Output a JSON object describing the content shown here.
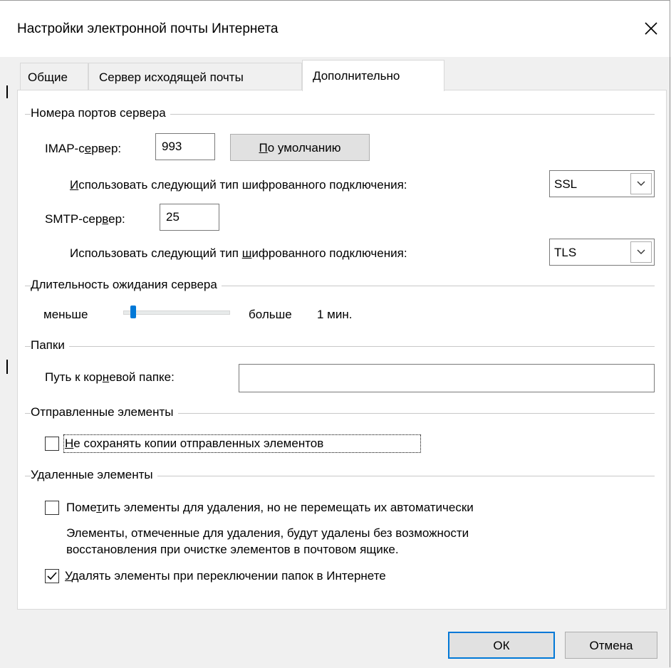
{
  "window": {
    "title": "Настройки электронной почты Интернета",
    "close_icon": "close-icon"
  },
  "tabs": [
    {
      "label": "Общие",
      "active": false
    },
    {
      "label": "Сервер исходящей почты",
      "active": false
    },
    {
      "label": "Дополнительно",
      "active": true
    }
  ],
  "ports": {
    "group_title": "Номера портов сервера",
    "imap_label_pre": "IMAP-с",
    "imap_label_ul": "е",
    "imap_label_post": "рвер:",
    "imap_value": "993",
    "default_button_pre": "",
    "default_button_ul": "П",
    "default_button_post": "о умолчанию",
    "imap_encryption_label_pre": "",
    "imap_encryption_label_ul": "И",
    "imap_encryption_label_post": "спользовать следующий тип шифрованного подключения:",
    "imap_encryption_value": "SSL",
    "smtp_label_pre": "SMTP-сер",
    "smtp_label_ul": "в",
    "smtp_label_post": "ер:",
    "smtp_value": "25",
    "smtp_encryption_label_pre": "Использовать следующий тип ",
    "smtp_encryption_label_ul": "ш",
    "smtp_encryption_label_post": "ифрованного подключения:",
    "smtp_encryption_value": "TLS"
  },
  "timeout": {
    "group_title_ul": "Д",
    "group_title_post": "лительность ожидания сервера",
    "less_label": "меньше",
    "more_label": "больше",
    "value_label": "1 мин.",
    "slider_fraction": 0.07
  },
  "folders": {
    "group_title": "Папки",
    "root_path_label_pre": "Путь к кор",
    "root_path_label_ul": "н",
    "root_path_label_post": "евой папке:",
    "root_path_value": ""
  },
  "sent": {
    "group_title": "Отправленные элементы",
    "dont_save_label_pre": "",
    "dont_save_label_ul": "Н",
    "dont_save_label_post": "е сохранять копии отправленных элементов",
    "dont_save_checked": false
  },
  "deleted": {
    "group_title": "Удаленные элементы",
    "mark_label_pre": "Поме",
    "mark_label_ul": "т",
    "mark_label_post": "ить элементы для удаления, но не перемещать их автоматически",
    "mark_checked": false,
    "description_line1": "Элементы, отмеченные для удаления, будут удалены без возможности",
    "description_line2": "восстановления при очистке элементов в почтовом ящике.",
    "purge_label_pre": "",
    "purge_label_ul": "У",
    "purge_label_post": "далять элементы при переключении папок в Интернете",
    "purge_checked": true
  },
  "buttons": {
    "ok": "ОК",
    "cancel": "Отмена"
  },
  "colors": {
    "accent": "#0078d7",
    "panel": "#ffffff",
    "dialog": "#f0f0f0"
  }
}
